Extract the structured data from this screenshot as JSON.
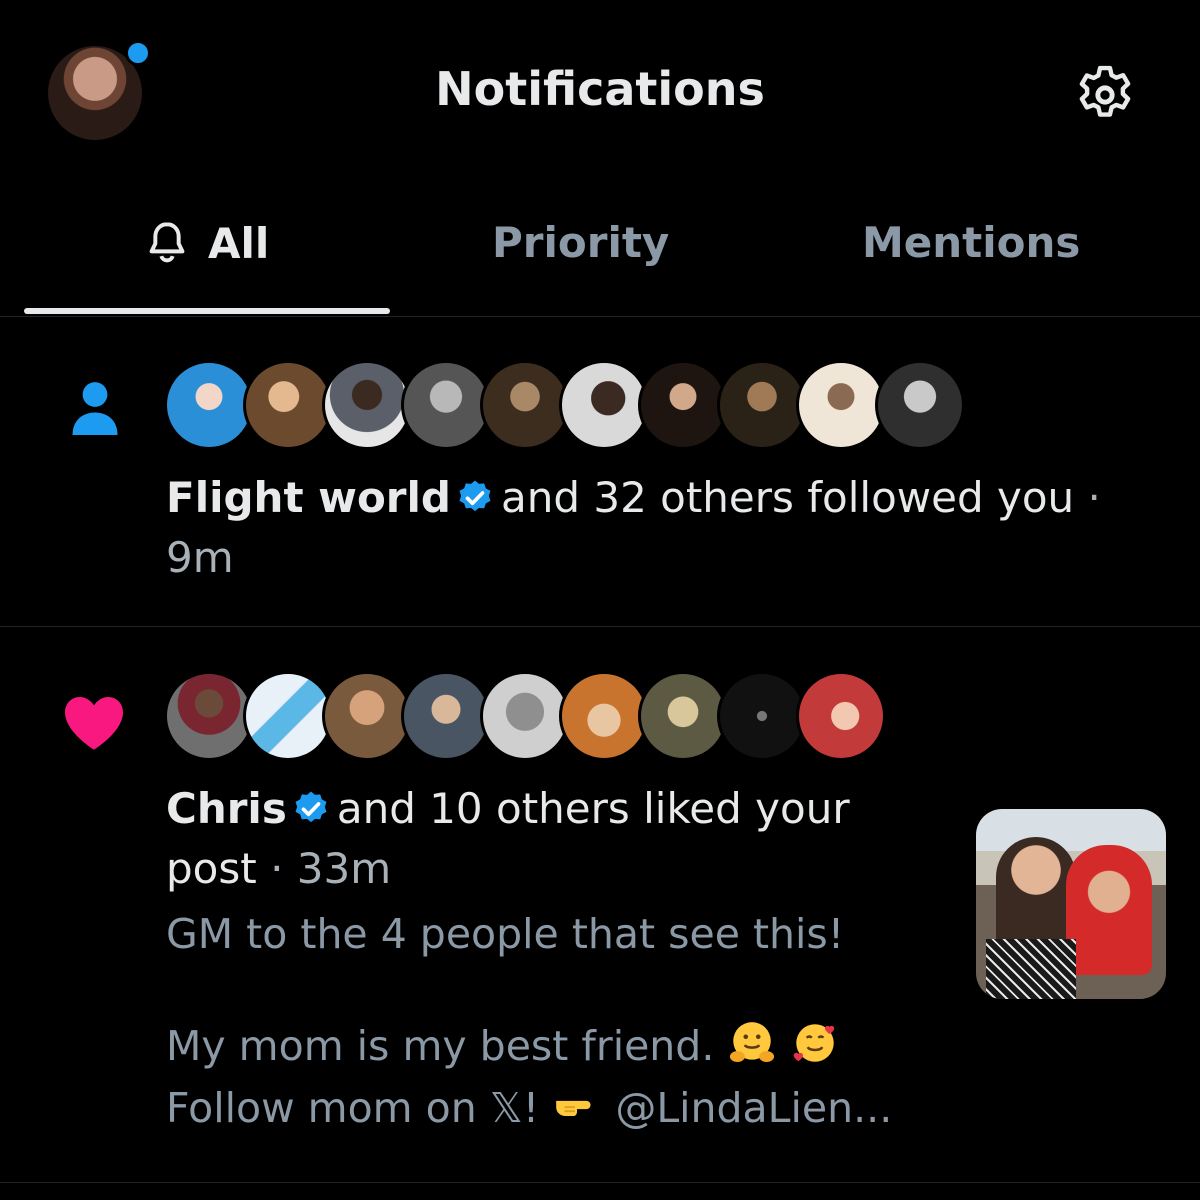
{
  "header": {
    "title": "Notifications",
    "has_unread_dot": true
  },
  "tabs": [
    {
      "label": "All",
      "active": true
    },
    {
      "label": "Priority",
      "active": false
    },
    {
      "label": "Mentions",
      "active": false
    }
  ],
  "notifications": [
    {
      "type": "follow",
      "icon": "person-icon",
      "avatar_colors": [
        "#2a8fd6",
        "#6b4a2e",
        "#e6e6e6",
        "#7a7a7a",
        "#6a5338",
        "#d9d9d9",
        "#3b2a20",
        "#3b2f1f",
        "#c9b49a",
        "#3a3a3a"
      ],
      "name": "Flight world",
      "verified": true,
      "action": "and 32 others followed you",
      "separator": "·",
      "time": "9m"
    },
    {
      "type": "like",
      "icon": "heart-icon",
      "avatar_colors": [
        "#6f6f6f",
        "#e8f1f8",
        "#7a5a3c",
        "#4a5563",
        "#cfcfcf",
        "#c9742e",
        "#5d5a44",
        "#111111",
        "#c23a3a"
      ],
      "name": "Chris",
      "verified": true,
      "action_line1": "and 10 others liked your",
      "action_line2": "post",
      "separator": "·",
      "time": "33m",
      "post_line1": "GM to the 4 people that see this!",
      "post_line2": "My mom is my best friend.",
      "post_line3_a": "Follow mom on 𝕏!",
      "post_line3_b": "@LindaLien...",
      "emojis": [
        "hugging-face-emoji",
        "smiling-face-with-hearts-emoji",
        "backhand-pointing-right-emoji"
      ]
    }
  ],
  "colors": {
    "background": "#000000",
    "text_primary": "#e7e9ea",
    "text_secondary": "#8b98a5",
    "accent_blue": "#1d9bf0",
    "like_pink": "#f91880"
  }
}
